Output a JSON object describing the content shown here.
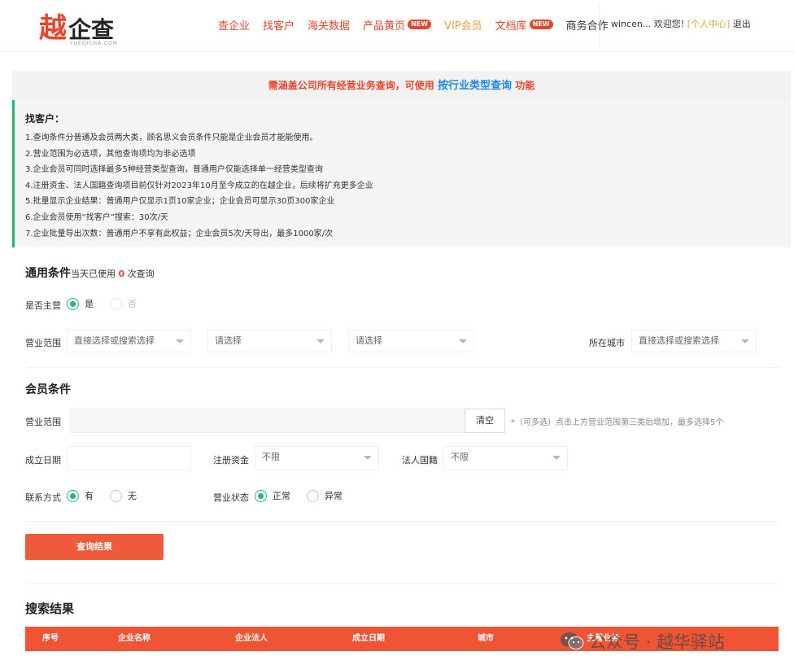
{
  "header": {
    "logo_mark": "越",
    "logo_text": "企查",
    "logo_sub": "YUEQICHA.COM",
    "nav": [
      {
        "label": "查企业",
        "badge": ""
      },
      {
        "label": "找客户",
        "badge": ""
      },
      {
        "label": "海关数据",
        "badge": ""
      },
      {
        "label": "产品黄页",
        "badge": "NEW"
      },
      {
        "label": "VIP会员",
        "badge": ""
      },
      {
        "label": "文档库",
        "badge": "NEW"
      },
      {
        "label": "商务合作",
        "badge": ""
      }
    ],
    "user": {
      "greeting": "wincen... 欢迎您!",
      "user_center": "[个人中心]",
      "logout": "退出"
    }
  },
  "notice": {
    "prefix": "需涵盖公司所有经营业务查询，可使用",
    "link": "按行业类型查询",
    "suffix": "功能"
  },
  "tips": {
    "title": "找客户：",
    "lines": [
      "1.查询条件分普通及会员两大类，顾名思义会员条件只能是企业会员才能能使用。",
      "2.营业范围为必选项，其他查询项均为非必选项",
      "3.企业会员可同时选择最多5种经营类型查询，普通用户仅能选择单一经营类型查询",
      "4.注册资金、法人国籍查询项目前仅针对2023年10月至今成立的在越企业，后续将扩充更多企业",
      "5.批量显示企业结果：普通用户仅显示1页10家企业；企业会员可显示30页300家企业",
      "6.企业会员使用“找客户”搜索：30次/天",
      "7.企业批量导出次数：普通用户不享有此权益；企业会员5次/天导出，最多1000家/次"
    ]
  },
  "general": {
    "title": "通用条件",
    "usage_prefix": "当天已使用",
    "usage_count": "0",
    "usage_suffix": "次查询",
    "main_business_label": "是否主营",
    "main_yes": "是",
    "main_no": "否",
    "scope_label": "营业范围",
    "scope_select1": "直接选择或搜索选择",
    "scope_select2": "请选择",
    "scope_select3": "请选择",
    "city_label": "所在城市",
    "city_select": "直接选择或搜索选择"
  },
  "member": {
    "title": "会员条件",
    "scope_label": "营业范围",
    "clear_button": "清空",
    "hint": "*（可多选）点击上方营业范围第三类后增加，最多选择5个",
    "founded_label": "成立日期",
    "capital_label": "注册资金",
    "capital_value": "不限",
    "nationality_label": "法人国籍",
    "nationality_value": "不限",
    "contact_label": "联系方式",
    "contact_yes": "有",
    "contact_no": "无",
    "status_label": "营业状态",
    "status_normal": "正常",
    "status_abnormal": "异常"
  },
  "query_button": "查询结果",
  "results": {
    "title": "搜索结果",
    "columns": [
      "序号",
      "企业名称",
      "企业法人",
      "成立日期",
      "城市",
      "主营业务"
    ]
  },
  "watermark": "公众号 · 越华驿站",
  "colors": {
    "brand": "#e8452c",
    "accent_green": "#22b96a",
    "link_blue": "#1e88e5",
    "table_header": "#ef5535"
  }
}
